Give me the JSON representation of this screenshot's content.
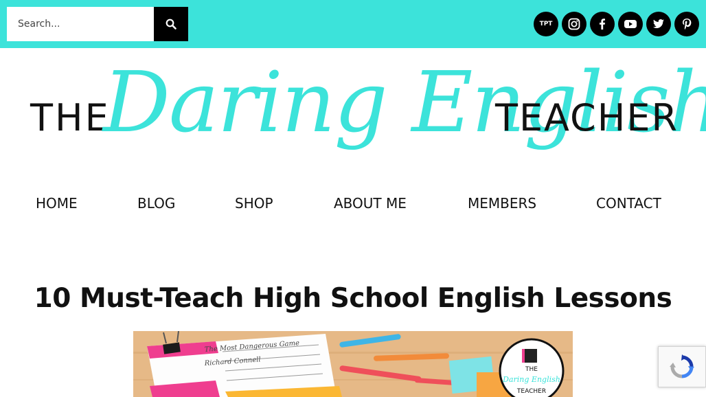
{
  "header": {
    "search": {
      "placeholder": "Search..."
    },
    "social_icons": [
      {
        "name": "tpt-icon",
        "label": "TPT"
      },
      {
        "name": "instagram-icon"
      },
      {
        "name": "facebook-icon"
      },
      {
        "name": "youtube-icon"
      },
      {
        "name": "twitter-icon"
      },
      {
        "name": "pinterest-icon"
      }
    ],
    "accent_color": "#3ce3da"
  },
  "logo": {
    "the": "THE",
    "script": "Daring English",
    "teacher": "TEACHER"
  },
  "nav": {
    "items": [
      "HOME",
      "BLOG",
      "SHOP",
      "ABOUT ME",
      "MEMBERS",
      "CONTACT"
    ]
  },
  "post": {
    "title": "10 Must-Teach High School English Lessons"
  },
  "hero_image": {
    "handout_text_1": "The Most Dangerous Game",
    "handout_text_2": "Richard Connell",
    "badge_the": "THE",
    "badge_script": "Daring English",
    "badge_teacher": "TEACHER"
  }
}
